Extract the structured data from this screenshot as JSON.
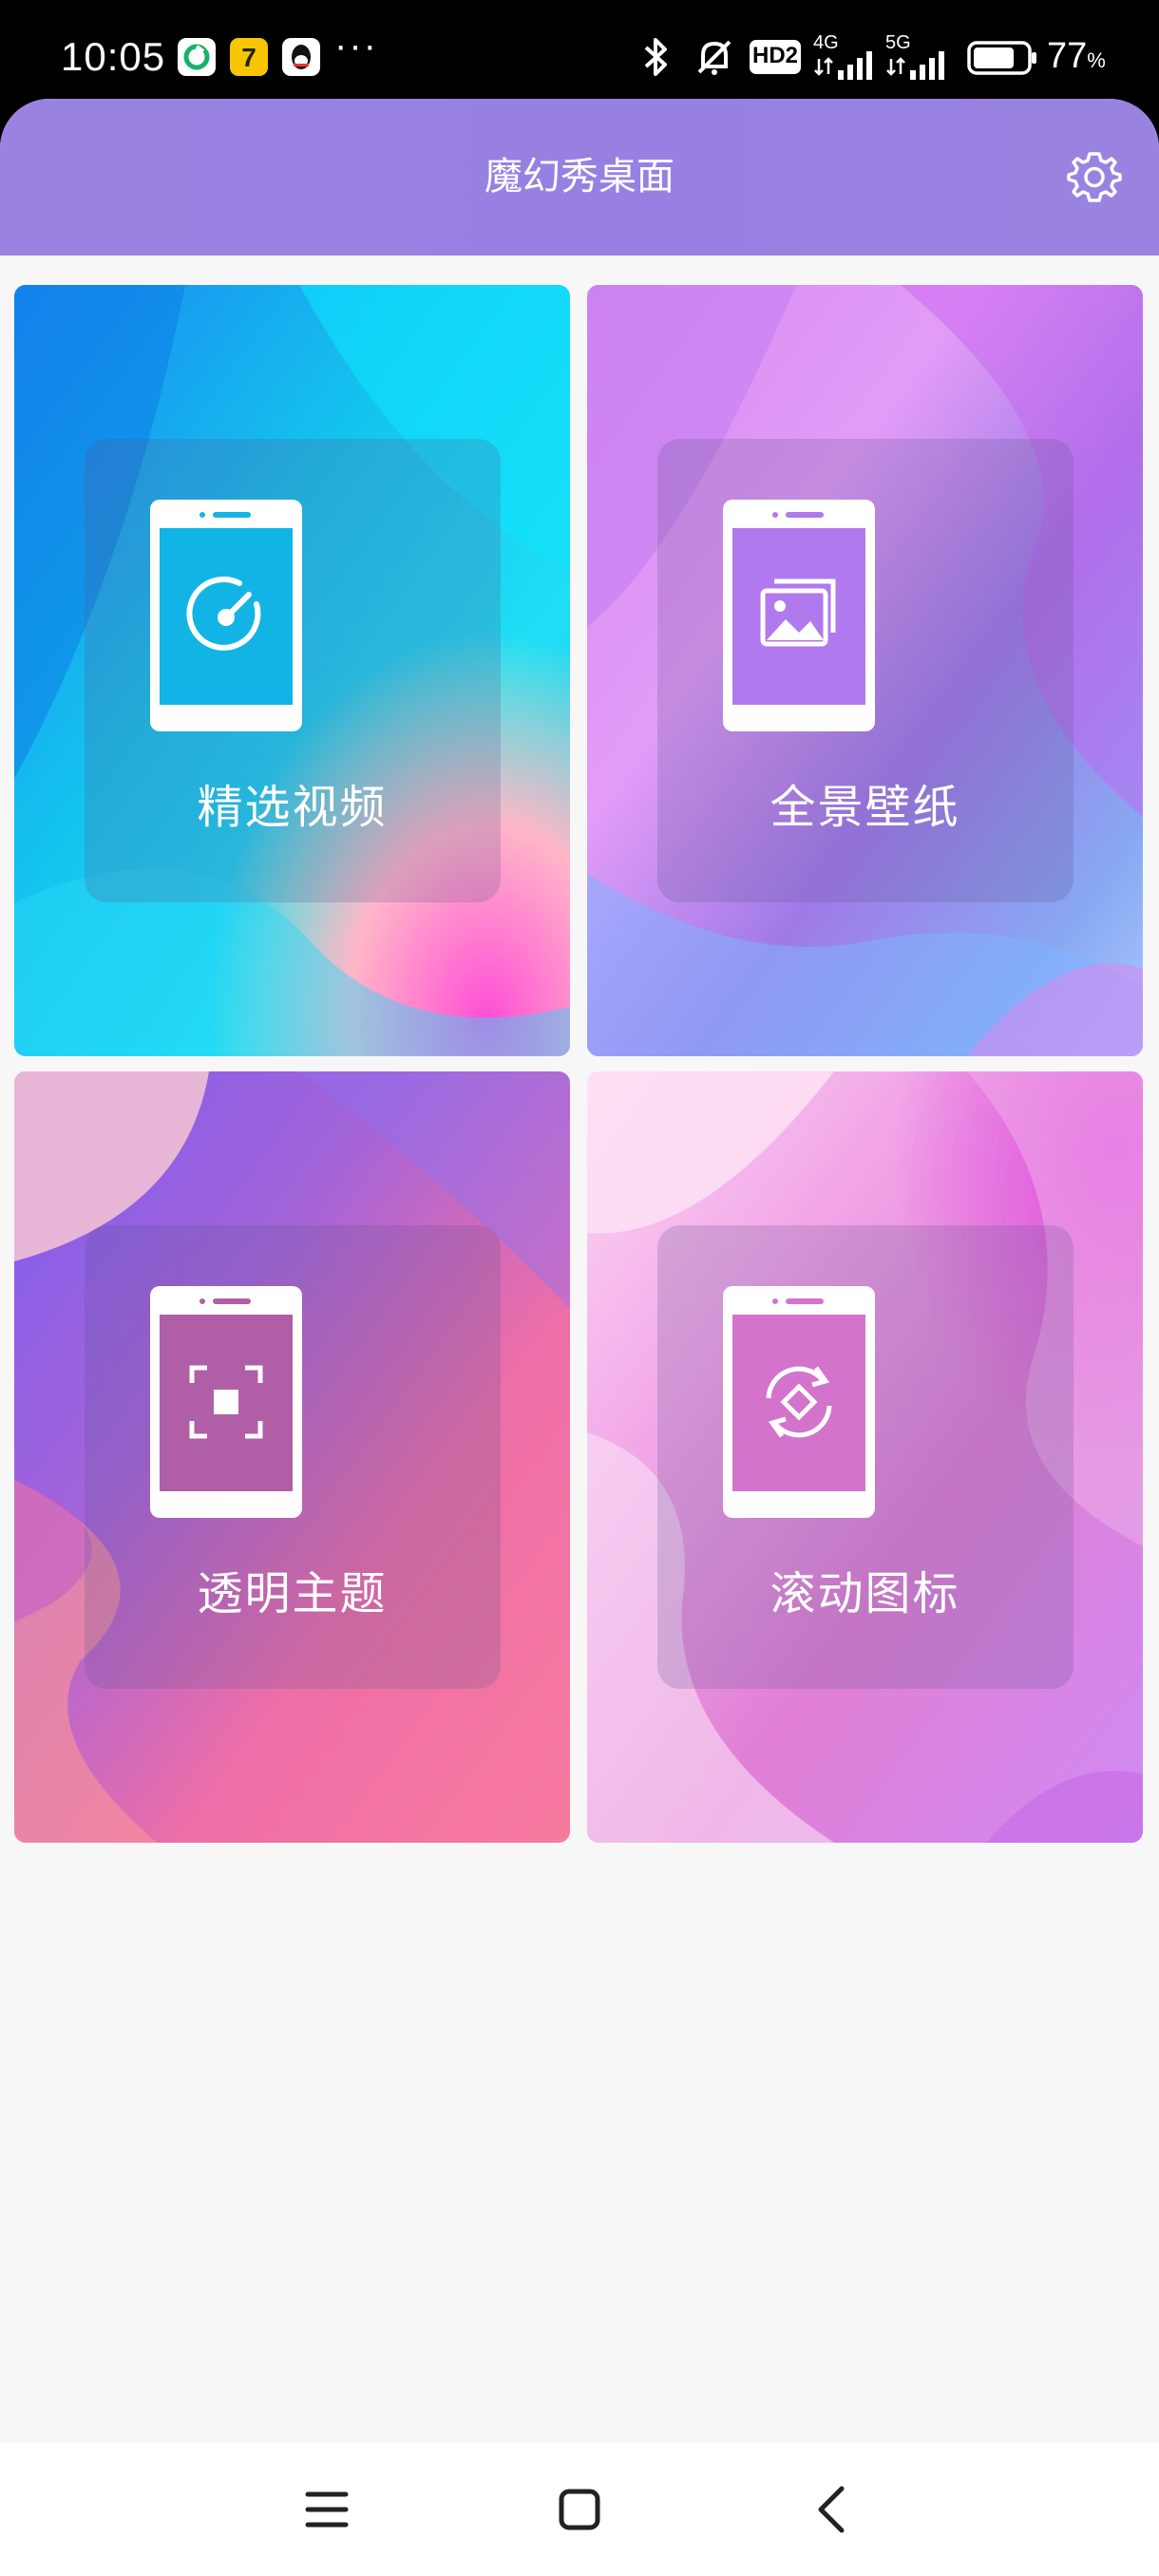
{
  "status_bar": {
    "time": "10:05",
    "more": "···",
    "network_badge": "HD2",
    "signal_1_label": "4G",
    "signal_2_label": "5G",
    "battery_percent": "77",
    "battery_unit": "%",
    "battery_level": 0.77,
    "icons": [
      "app-notification-icon",
      "app-notification-icon",
      "qq-icon",
      "bluetooth-icon",
      "mute-icon",
      "signal-icon",
      "battery-icon"
    ]
  },
  "header": {
    "title": "魔幻秀桌面",
    "settings_icon": "gear-icon"
  },
  "cards": [
    {
      "label": "精选视频",
      "icon": "video-dial-icon",
      "accent": "#12b4e6"
    },
    {
      "label": "全景壁纸",
      "icon": "image-gallery-icon",
      "accent": "#b079ee"
    },
    {
      "label": "透明主题",
      "icon": "transparent-focus-icon",
      "accent": "#c4609e"
    },
    {
      "label": "滚动图标",
      "icon": "rotate-icon",
      "accent": "#e07fd4"
    }
  ],
  "nav": {
    "menu_icon": "menu-icon",
    "home_icon": "home-icon",
    "back_icon": "back-icon"
  }
}
